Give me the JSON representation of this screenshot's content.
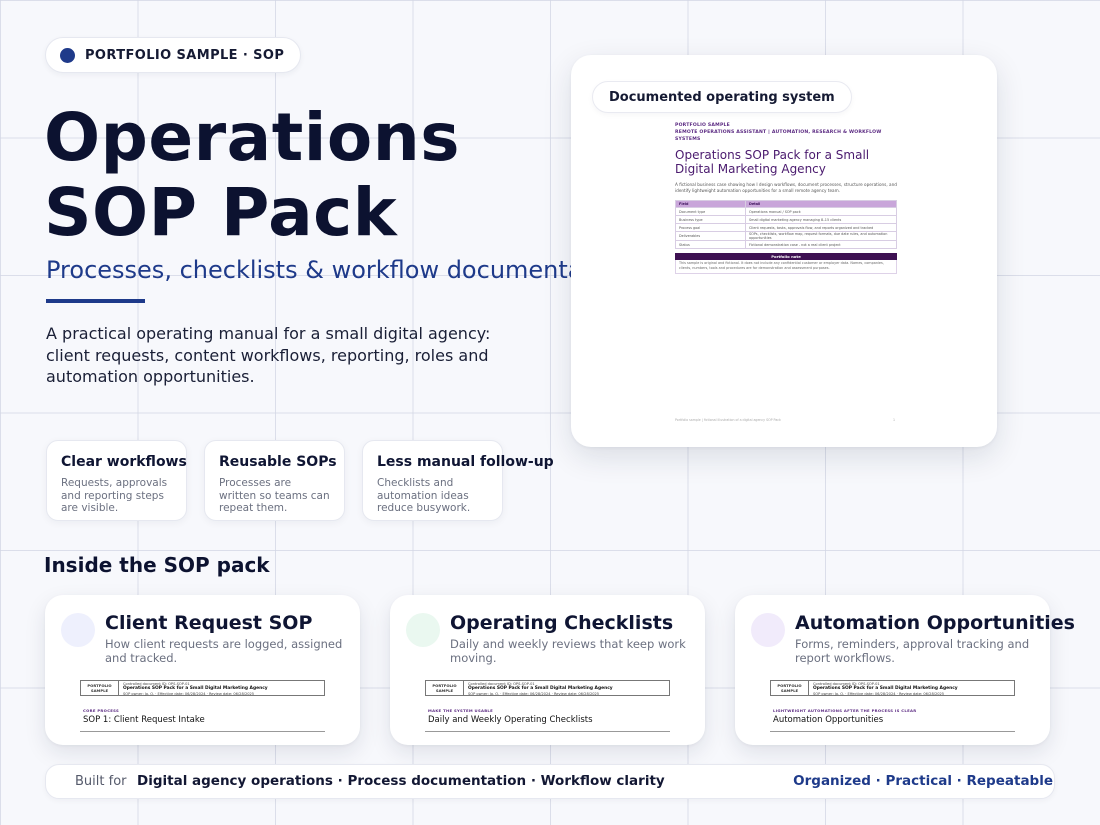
{
  "badge": {
    "text": "PORTFOLIO SAMPLE · SOP"
  },
  "hero": {
    "title_line1": "Operations",
    "title_line2": "SOP Pack",
    "subtitle": "Processes, checklists & workflow documentation",
    "description": "A practical operating manual for a small digital agency: client requests, content workflows, reporting, roles and automation opportunities."
  },
  "features": [
    {
      "title": "Clear workflows",
      "text": "Requests, approvals and reporting steps are visible."
    },
    {
      "title": "Reusable SOPs",
      "text": "Processes are written so teams can repeat them."
    },
    {
      "title": "Less manual follow-up",
      "text": "Checklists and automation ideas reduce busywork."
    }
  ],
  "preview": {
    "label": "Documented operating system",
    "kicker": "PORTFOLIO SAMPLE",
    "subkicker": "REMOTE OPERATIONS ASSISTANT | AUTOMATION, RESEARCH & WORKFLOW SYSTEMS",
    "title_line1": "Operations SOP Pack for a Small",
    "title_line2": "Digital Marketing Agency",
    "intro": "A fictional business case showing how I design workflows, document processes, structure operations, and identify lightweight automation opportunities for a small remote agency team.",
    "table_header": [
      "Field",
      "Detail"
    ],
    "table_rows": [
      [
        "Document type",
        "Operations manual / SOP pack"
      ],
      [
        "Business type",
        "Small digital marketing agency managing 8–15 clients"
      ],
      [
        "Process goal",
        "Client requests, tasks, approvals flow, and reports organized and tracked"
      ],
      [
        "Deliverables",
        "SOPs, checklists, workflow map, request formats, due date rules, and automation opportunities"
      ],
      [
        "Status",
        "Fictional demonstration case - not a real client project"
      ]
    ],
    "note_head": "Portfolio note",
    "note_body": "This sample is original and fictional. It does not include any confidential customer or employer data. Names, companies, clients, numbers, tools and procedures are for demonstration and assessment purposes.",
    "footer": "Portfolio sample | fictional illustration of a digital agency SOP Pack",
    "page_number": "1"
  },
  "section": {
    "title": "Inside the SOP pack"
  },
  "sop_cards": [
    {
      "title": "Client Request SOP",
      "text": "How client requests are logged, assigned and tracked.",
      "color": "#eef0fd",
      "mini_left": "PORTFOLIO SAMPLE",
      "mini_meta1": "Controlled document ID: OPS-SOP-01",
      "mini_doc": "Operations SOP Pack for a Small Digital Marketing Agency",
      "mini_meta2": "SOP owner: Jo. O. · Effective date: 06/28/2024 · Review date: 06/28/2025",
      "kicker": "CORE PROCESS",
      "mini_title": "SOP 1: Client Request Intake"
    },
    {
      "title": "Operating Checklists",
      "text": "Daily and weekly reviews that keep work moving.",
      "color": "#eaf8f0",
      "mini_left": "PORTFOLIO SAMPLE",
      "mini_meta1": "Controlled document ID: OPS-SOP-01",
      "mini_doc": "Operations SOP Pack for a Small Digital Marketing Agency",
      "mini_meta2": "SOP owner: Jo. O. · Effective date: 06/28/2024 · Review date: 06/28/2025",
      "kicker": "MAKE THE SYSTEM USABLE",
      "mini_title": "Daily and Weekly Operating Checklists"
    },
    {
      "title": "Automation Opportunities",
      "text": "Forms, reminders, approval tracking and report workflows.",
      "color": "#f1ebfb",
      "mini_left": "PORTFOLIO SAMPLE",
      "mini_meta1": "Controlled document ID: OPS-SOP-01",
      "mini_doc": "Operations SOP Pack for a Small Digital Marketing Agency",
      "mini_meta2": "SOP owner: Jo. O. · Effective date: 06/28/2024 · Review date: 06/28/2025",
      "kicker": "LIGHTWEIGHT AUTOMATIONS AFTER THE PROCESS IS CLEAR",
      "mini_title": "Automation Opportunities"
    }
  ],
  "footer": {
    "label": "Built for",
    "items": "Digital agency operations · Process documentation · Workflow clarity",
    "tags": "Organized · Practical · Repeatable"
  }
}
